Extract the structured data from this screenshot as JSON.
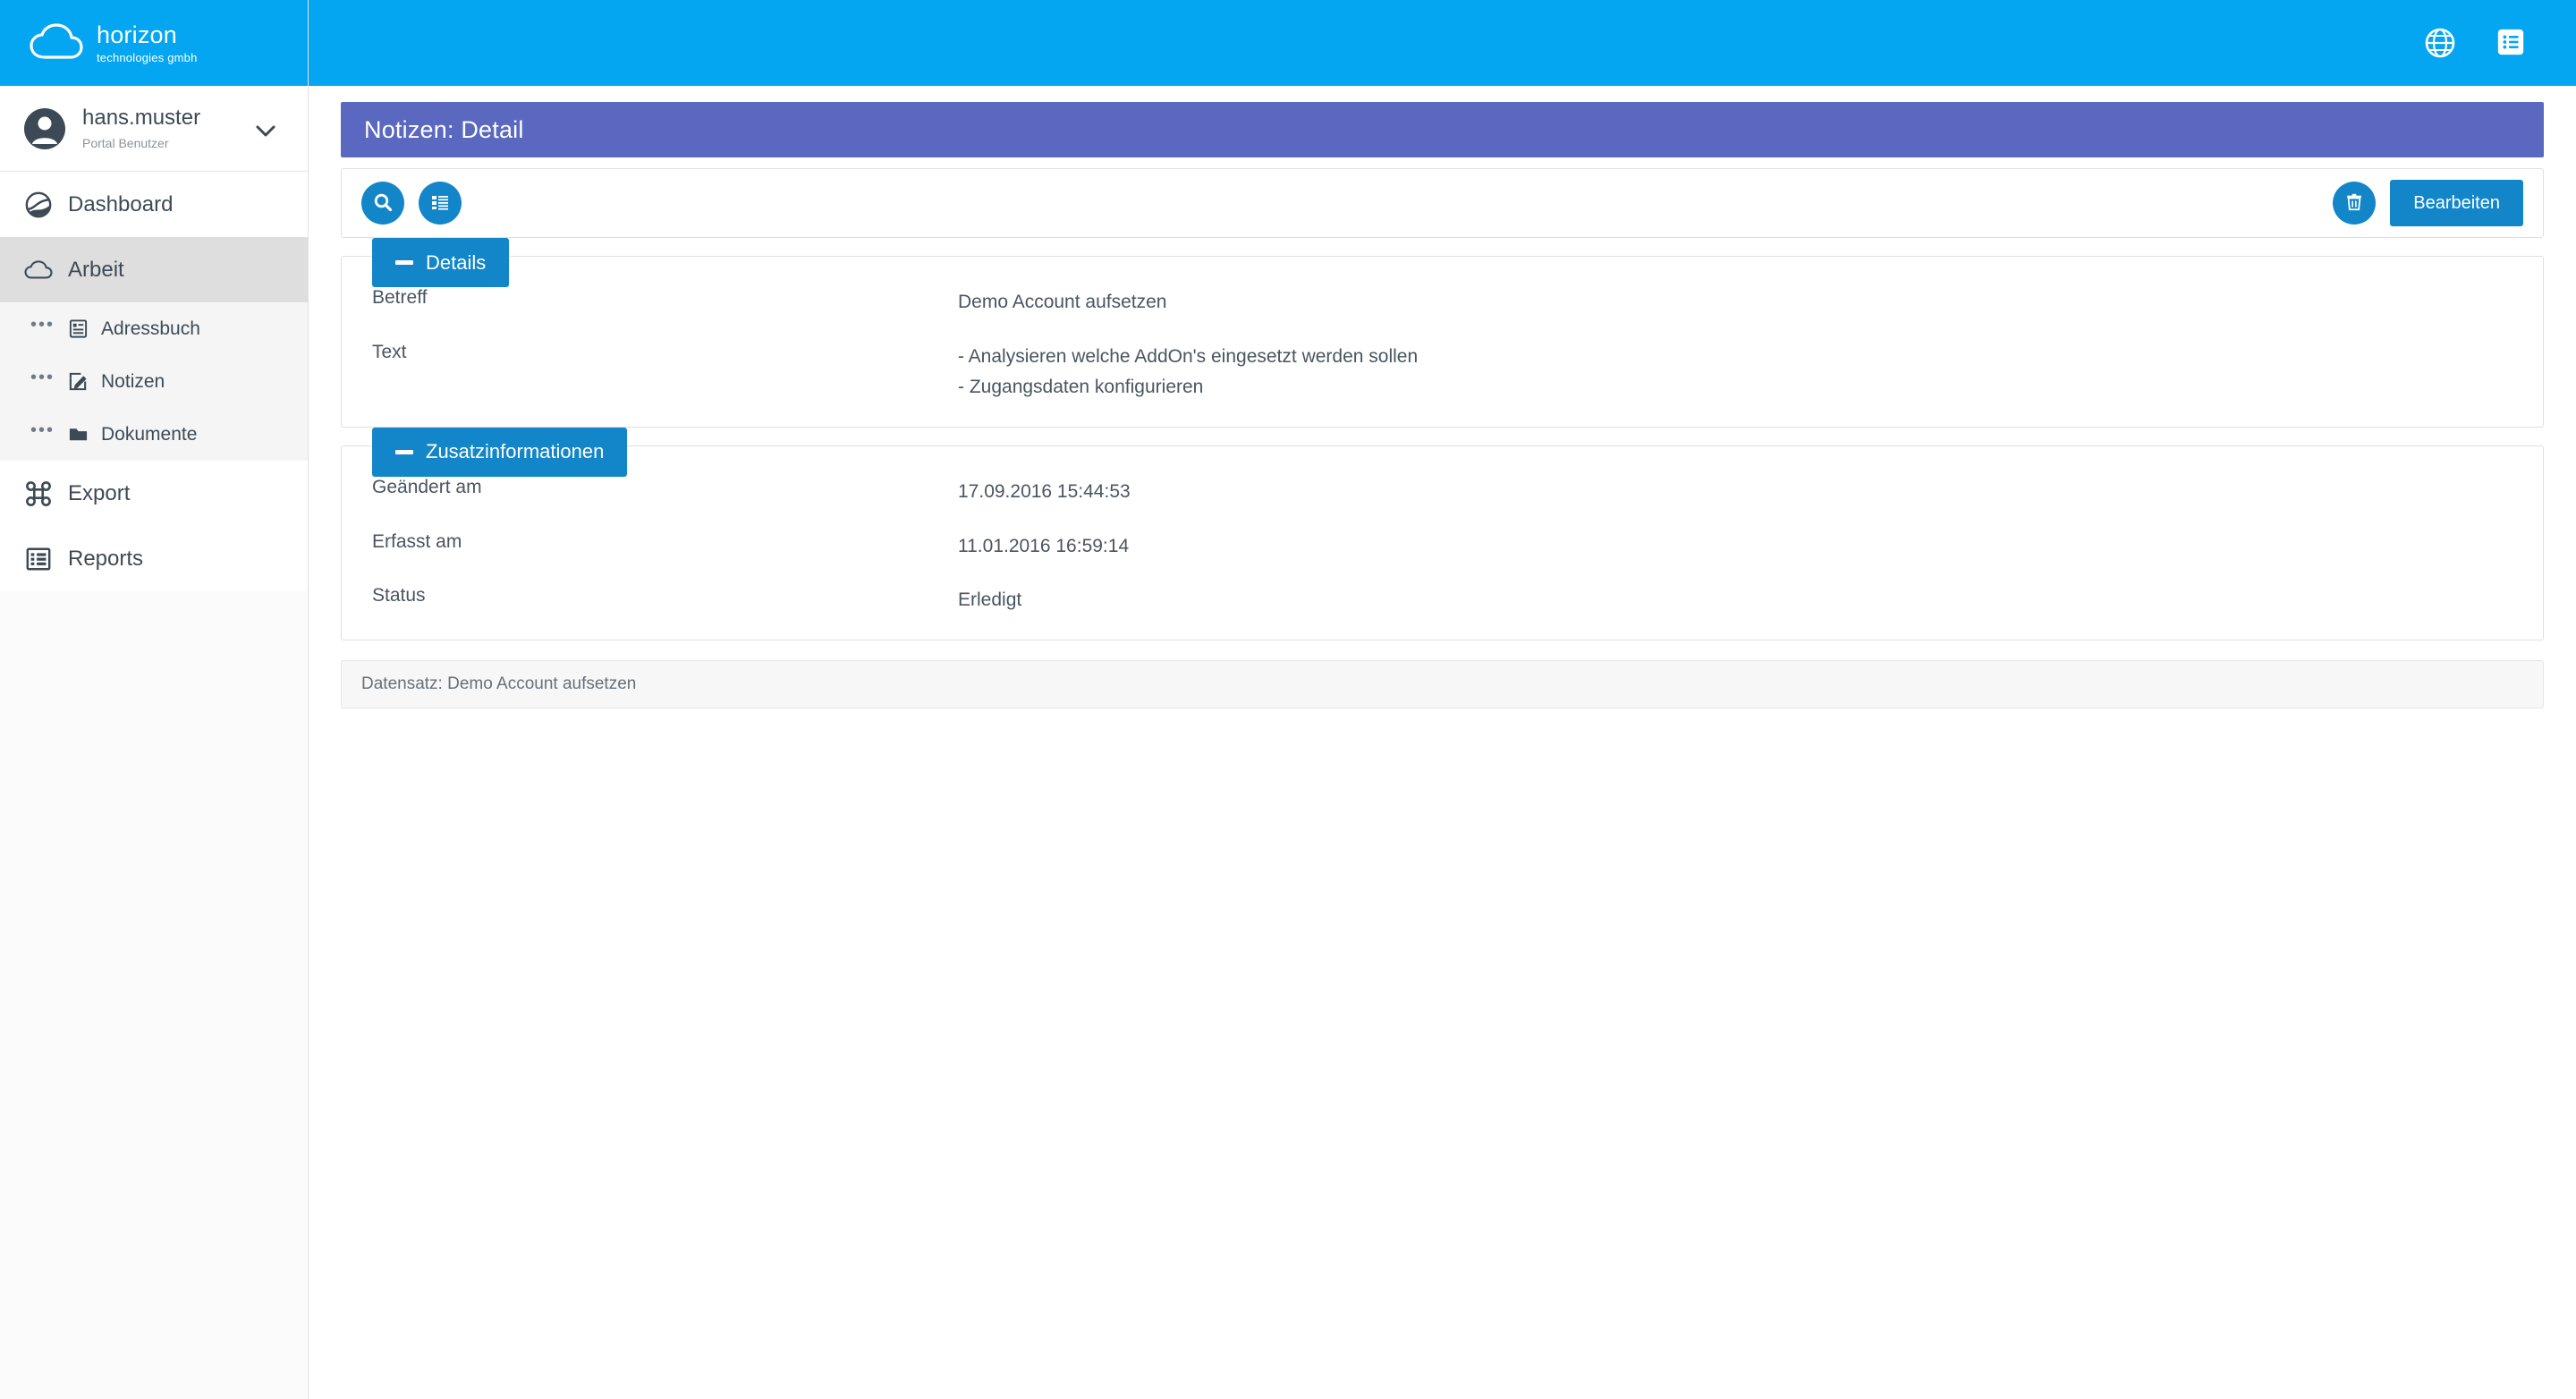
{
  "brand": {
    "logo_icon": "cloud-icon",
    "name": "horizon",
    "tagline": "technologies gmbh",
    "header_color": "#04a6f2"
  },
  "user": {
    "avatar_icon": "user-avatar-icon",
    "name": "hans.muster",
    "role": "Portal Benutzer",
    "chevron_icon": "chevron-down-icon"
  },
  "sidebar": {
    "items": [
      {
        "label": "Dashboard",
        "icon": "dashboard-icon",
        "active": false
      },
      {
        "label": "Arbeit",
        "icon": "cloud-icon",
        "active": true
      },
      {
        "label": "Export",
        "icon": "command-icon",
        "active": false
      },
      {
        "label": "Reports",
        "icon": "report-table-icon",
        "active": false
      }
    ],
    "sub_items": [
      {
        "label": "Adressbuch",
        "icon": "address-book-icon"
      },
      {
        "label": "Notizen",
        "icon": "edit-note-icon"
      },
      {
        "label": "Dokumente",
        "icon": "folder-icon"
      }
    ],
    "bullet": "•••"
  },
  "topbar": {
    "globe_icon": "globe-icon",
    "list_icon": "list-menu-icon"
  },
  "page": {
    "title": "Notizen: Detail",
    "title_bar_color": "#5a68c0"
  },
  "toolbar": {
    "search_icon": "search-icon",
    "list_icon": "list-icon",
    "delete_icon": "trash-icon",
    "edit_label": "Bearbeiten",
    "accent_color": "#1286c9"
  },
  "sections": [
    {
      "title": "Details",
      "collapse_icon": "minus-icon",
      "fields": [
        {
          "label": "Betreff",
          "lines": [
            "Demo Account aufsetzen"
          ]
        },
        {
          "label": "Text",
          "lines": [
            "- Analysieren welche AddOn's eingesetzt werden sollen",
            "- Zugangsdaten konfigurieren"
          ]
        }
      ]
    },
    {
      "title": "Zusatzinformationen",
      "collapse_icon": "minus-icon",
      "fields": [
        {
          "label": "Geändert am",
          "lines": [
            "17.09.2016 15:44:53"
          ]
        },
        {
          "label": "Erfasst am",
          "lines": [
            "11.01.2016 16:59:14"
          ]
        },
        {
          "label": "Status",
          "lines": [
            "Erledigt"
          ]
        }
      ]
    }
  ],
  "footer": {
    "text": "Datensatz: Demo Account aufsetzen"
  }
}
